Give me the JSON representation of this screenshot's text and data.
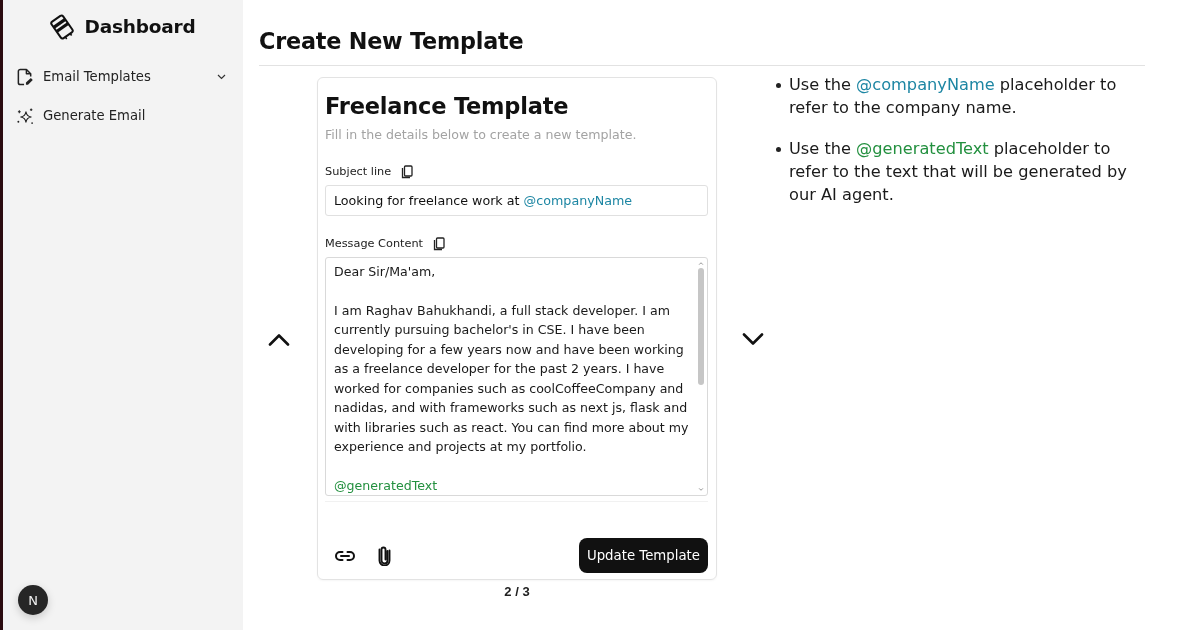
{
  "sidebar": {
    "brand": "Dashboard",
    "items": [
      {
        "kind": "group",
        "label": "Email Templates",
        "expanded": false,
        "selected": false
      },
      {
        "kind": "link",
        "label": "Generate Email",
        "selected": false
      }
    ]
  },
  "dev_badge": {
    "label": "N"
  },
  "page": {
    "title": "Create New Template"
  },
  "template_card": {
    "title": "Freelance Template",
    "subtitle": "Fill in the details below to create a new template.",
    "subject": {
      "label": "Subject line",
      "segments": [
        {
          "text": "Looking for freelance work at "
        },
        {
          "text": "@companyName",
          "color": "#1d86a3"
        }
      ]
    },
    "message": {
      "label": "Message Content",
      "paragraphs": [
        {
          "segments": [
            {
              "text": "Dear Sir/Ma'am,"
            }
          ]
        },
        {
          "segments": [
            {
              "text": "I am Raghav Bahukhandi, a full stack developer. I am currently pursuing bachelor's in CSE. I have been developing for a few years now and have been working as a freelance developer for the past 2 years. I have worked for companies such as coolCoffeeCompany and nadidas, and with frameworks such as next js, flask and with libraries such as react. You can find more about my experience and projects at my portfolio."
            }
          ]
        },
        {
          "segments": [
            {
              "text": "@generatedText",
              "color": "#23903f"
            }
          ]
        }
      ]
    },
    "submit_button": "Update Template"
  },
  "pager": {
    "text": "2 / 3"
  },
  "hints": [
    {
      "segments": [
        {
          "text": "Use the "
        },
        {
          "text": "@companyName",
          "color": "#1d86a3"
        },
        {
          "text": " placeholder to refer to the company name."
        }
      ]
    },
    {
      "segments": [
        {
          "text": "Use the "
        },
        {
          "text": "@generatedText",
          "color": "#23903f"
        },
        {
          "text": " placeholder to refer to the text that will be generated by our AI agent."
        }
      ]
    }
  ]
}
